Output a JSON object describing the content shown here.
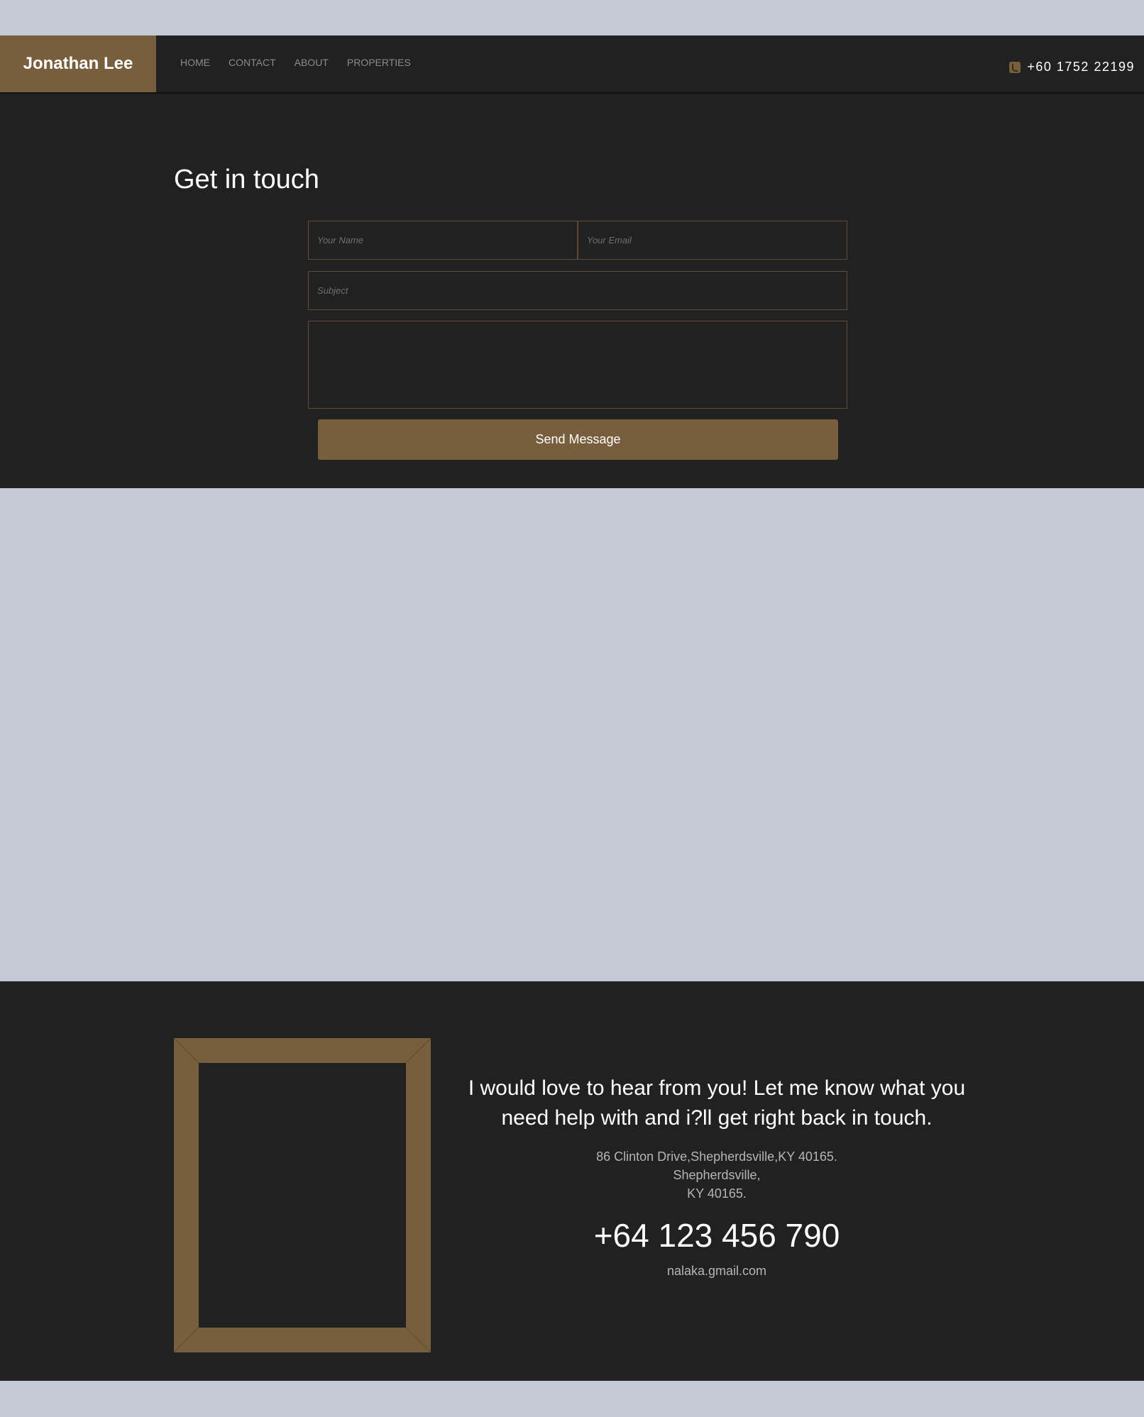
{
  "navbar": {
    "brand": "Jonathan Lee",
    "links": [
      "HOME",
      "CONTACT",
      "ABOUT",
      "PROPERTIES"
    ],
    "phone": "+60 1752 22199",
    "phone_icon": "phone-icon"
  },
  "contact": {
    "title": "Get in touch",
    "name_placeholder": "Your Name",
    "email_placeholder": "Your Email",
    "subject_placeholder": "Subject",
    "message_placeholder": "",
    "send_label": "Send Message"
  },
  "footer": {
    "message": "I would love to hear from you! Let me know what you need help with and i?ll get right back in touch.",
    "address_line1": "86 Clinton Drive,Shepherdsville,KY 40165.",
    "address_line2": "Shepherdsville,",
    "address_line3": "KY 40165.",
    "phone": "+64 123 456 790",
    "email": "nalaka.gmail.com"
  },
  "colors": {
    "accent": "#775f3d",
    "dark": "#212121",
    "page_background": "#c4cbd6"
  }
}
